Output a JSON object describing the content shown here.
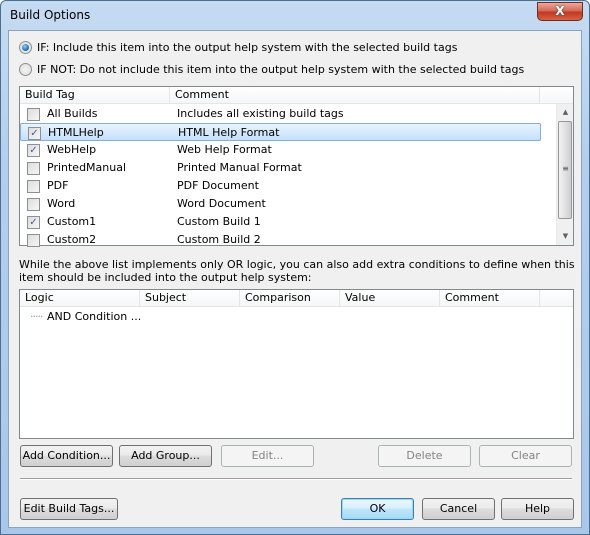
{
  "window": {
    "title": "Build Options",
    "close_label": "X"
  },
  "mode": {
    "options": [
      {
        "label": "IF: Include this item into the output help system with the selected build tags",
        "selected": true
      },
      {
        "label": "IF NOT: Do not include this item into the output help system with the selected build tags",
        "selected": false
      }
    ]
  },
  "build_tags": {
    "columns": [
      "Build Tag",
      "Comment"
    ],
    "rows": [
      {
        "tag": "All Builds",
        "comment": "Includes all existing build tags",
        "checked": false,
        "selected": false
      },
      {
        "tag": "HTMLHelp",
        "comment": "HTML Help Format",
        "checked": true,
        "selected": true
      },
      {
        "tag": "WebHelp",
        "comment": "Web Help Format",
        "checked": true,
        "selected": false
      },
      {
        "tag": "PrintedManual",
        "comment": "Printed Manual Format",
        "checked": false,
        "selected": false
      },
      {
        "tag": "PDF",
        "comment": "PDF Document",
        "checked": false,
        "selected": false
      },
      {
        "tag": "Word",
        "comment": "Word Document",
        "checked": false,
        "selected": false
      },
      {
        "tag": "Custom1",
        "comment": "Custom Build 1",
        "checked": true,
        "selected": false
      },
      {
        "tag": "Custom2",
        "comment": "Custom Build 2",
        "checked": false,
        "selected": false
      }
    ],
    "check_glyph": "✓"
  },
  "description": "While the above list implements only OR logic, you can also add extra conditions to define when this item should be included into the output help system:",
  "conditions": {
    "columns": [
      "Logic",
      "Subject",
      "Comparison",
      "Value",
      "Comment"
    ],
    "rows": [
      {
        "logic": "AND Condition ..."
      }
    ]
  },
  "buttons": {
    "add_condition": "Add Condition...",
    "add_group": "Add Group...",
    "edit": "Edit...",
    "delete": "Delete",
    "clear": "Clear",
    "edit_build_tags": "Edit Build Tags...",
    "ok": "OK",
    "cancel": "Cancel",
    "help": "Help"
  }
}
